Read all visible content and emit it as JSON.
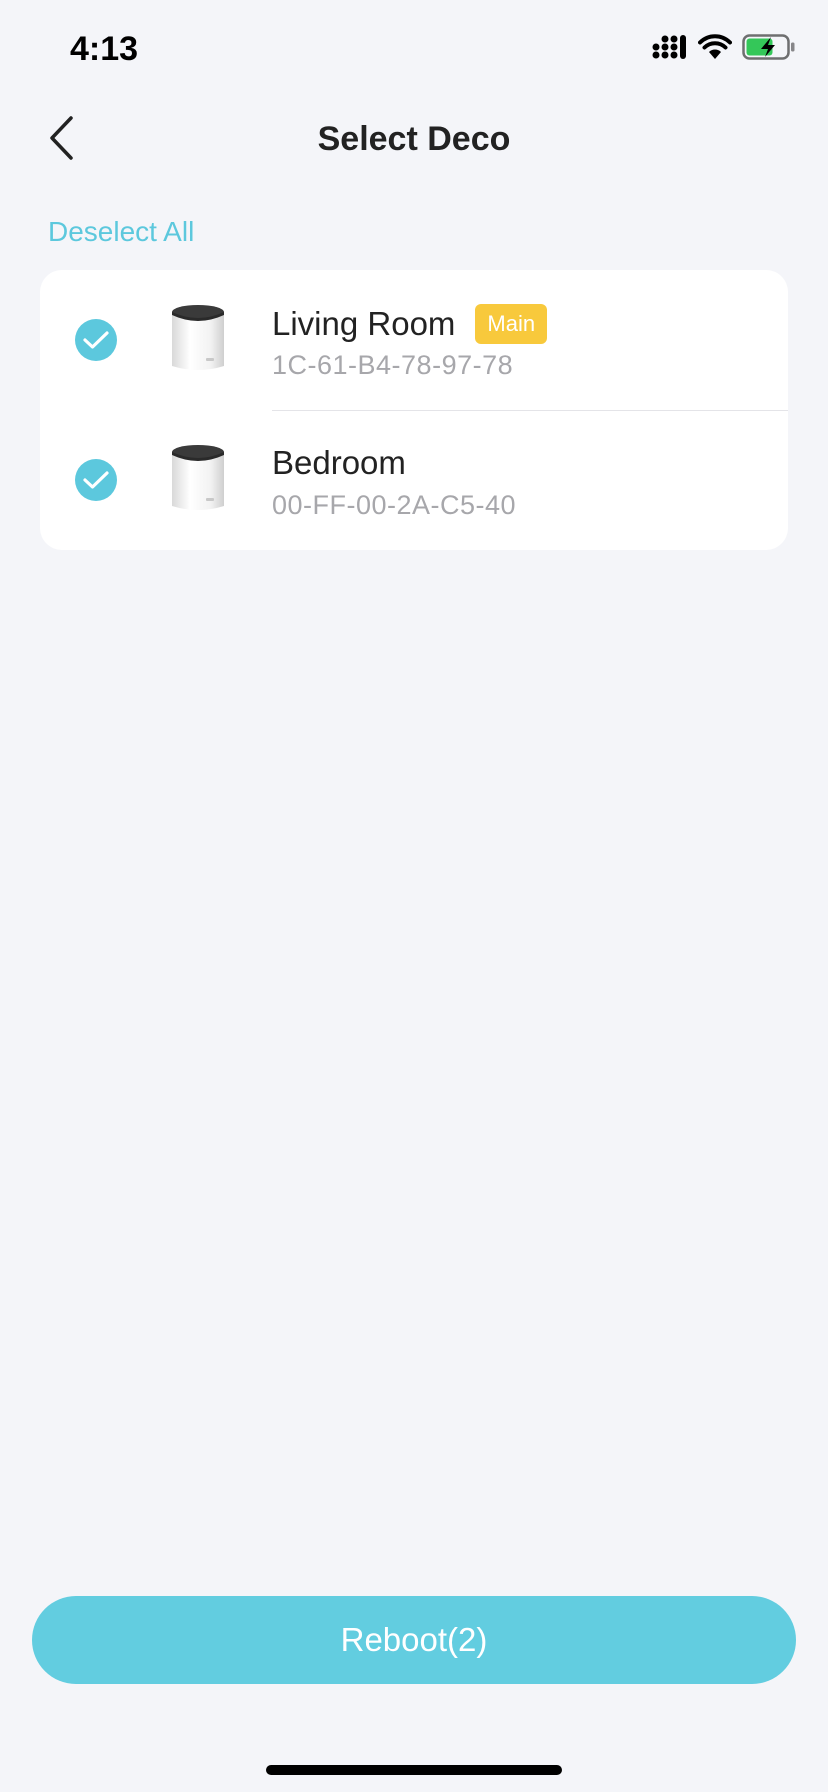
{
  "status_bar": {
    "time": "4:13",
    "icons": [
      "signal-icon",
      "wifi-icon",
      "battery-charging-icon"
    ]
  },
  "header": {
    "title": "Select Deco",
    "back_icon": "chevron-left-icon"
  },
  "deselect_all_label": "Deselect All",
  "devices": [
    {
      "name": "Living Room",
      "badge": "Main",
      "mac": "1C-61-B4-78-97-78",
      "selected": true
    },
    {
      "name": "Bedroom",
      "badge": "",
      "mac": "00-FF-00-2A-C5-40",
      "selected": true
    }
  ],
  "reboot_label": "Reboot(2)",
  "colors": {
    "accent": "#5cc8dd",
    "button": "#62cde0",
    "badge": "#f8c93c",
    "background": "#f4f5f9",
    "battery_fill": "#34c759"
  }
}
